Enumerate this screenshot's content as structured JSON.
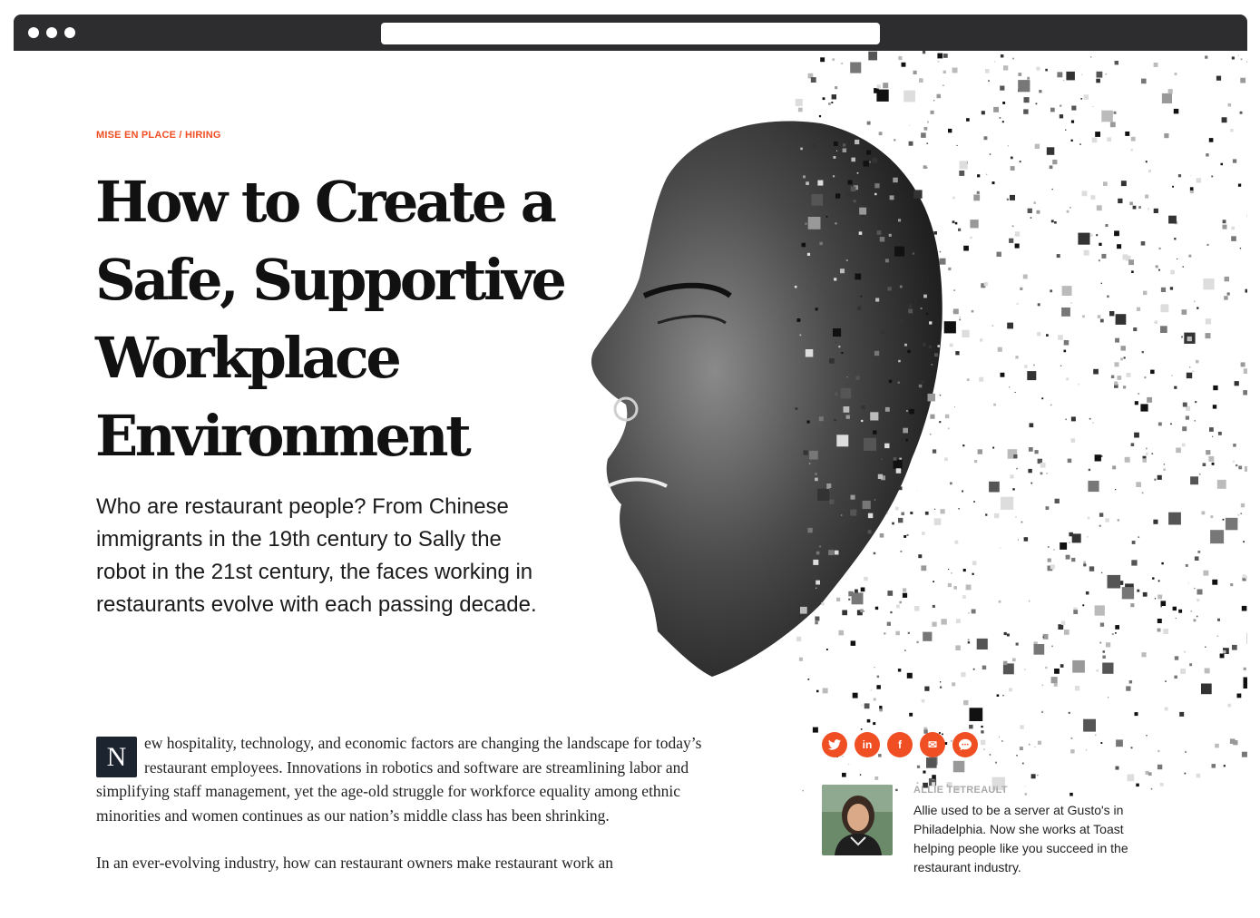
{
  "article": {
    "category": "MISE EN PLACE",
    "separator": " / ",
    "subcategory": "HIRING",
    "title": "How to Create a Safe, Supportive Workplace Environment",
    "dek": "Who are restaurant people? From Chinese immigrants in the 19th century to Sally the robot in the 21st century, the faces working in restaurants evolve with each passing decade.",
    "dropcap": "N",
    "paragraph1": "ew hospitality, technology, and economic factors are changing the landscape for today’s restaurant employees. Innovations in robotics and software are streamlining labor and simplifying staff management, yet the age-old struggle for workforce equality among ethnic minorities and women continues as our nation’s middle class has been shrinking.",
    "paragraph2": "In an ever-evolving industry, how can restaurant owners make restaurant work an"
  },
  "share": {
    "buttons": [
      {
        "icon": "twitter-icon",
        "glyph": ""
      },
      {
        "icon": "linkedin-icon",
        "glyph": "in"
      },
      {
        "icon": "facebook-icon",
        "glyph": "f"
      },
      {
        "icon": "email-icon",
        "glyph": "✉"
      },
      {
        "icon": "message-icon",
        "glyph": ""
      }
    ]
  },
  "author": {
    "name": "ALLIE TETREAULT",
    "bio": "Allie used to be a server at Gusto's in Philadelphia. Now she works at Toast helping people like you succeed in the restaurant industry."
  },
  "colors": {
    "accent": "#f04e23",
    "browser_chrome": "#2d2d2f",
    "dropcap_bg": "#1c2430"
  }
}
